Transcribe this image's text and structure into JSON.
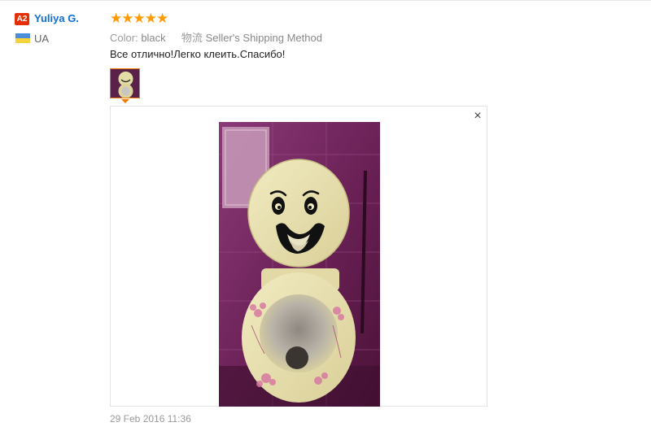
{
  "reviewer": {
    "level_badge": "A2",
    "name": "Yuliya G.",
    "country": "UA"
  },
  "review": {
    "rating_stars": 5,
    "stars_text": "★★★★★",
    "color_label": "Color:",
    "color_value": "black",
    "shipping_label": "物流",
    "shipping_value": "Seller's Shipping Method",
    "text": "Все отлично!Легко клеить.Спасибо!",
    "date": "29 Feb 2016 11:36"
  },
  "viewer": {
    "close_icon": "×"
  },
  "icons": {
    "flag": "ukraine-flag-icon",
    "close": "close-icon",
    "star": "star-icon"
  },
  "colors": {
    "name_link": "#0a6fd6",
    "star": "#ff9a00",
    "badge": "#e62e04",
    "thumb_border": "#f07c00"
  }
}
